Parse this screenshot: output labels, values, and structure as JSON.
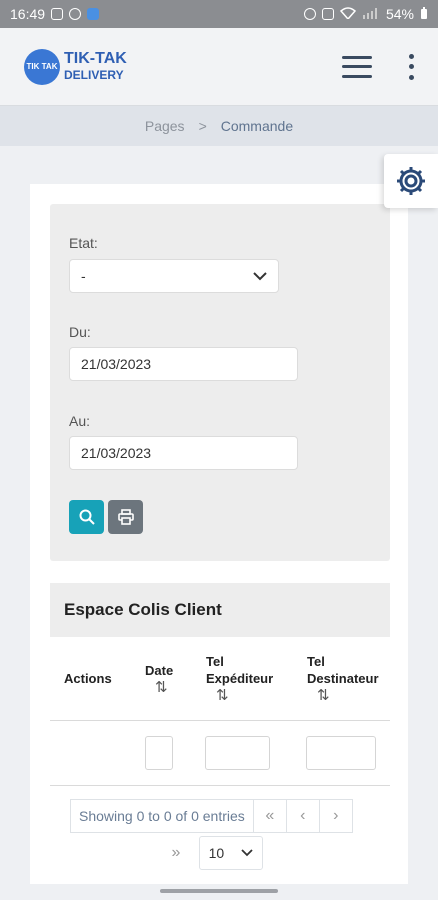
{
  "status_bar": {
    "time": "16:49",
    "battery": "54%"
  },
  "app": {
    "logo_line1": "TIK-TAK",
    "logo_line2": "DELIVERY",
    "logo_badge": "TIK TAK"
  },
  "breadcrumb": {
    "items": [
      "Pages",
      "Commande"
    ],
    "separator": ">"
  },
  "filters": {
    "etat_label": "Etat:",
    "etat_value": "-",
    "du_label": "Du:",
    "du_value": "21/03/2023",
    "au_label": "Au:",
    "au_value": "21/03/2023"
  },
  "table": {
    "title": "Espace Colis Client",
    "columns": [
      "Actions",
      "Date",
      "Tel Expéditeur",
      "Tel Destinateur"
    ],
    "sort_icon": "⇅"
  },
  "pagination": {
    "info": "Showing 0 to 0 of 0 entries",
    "first": "«",
    "prev": "‹",
    "next": "›",
    "last": "»",
    "page_size": "10"
  },
  "colors": {
    "accent": "#17a2b8",
    "secondary": "#6c757d",
    "brand": "#2f5fb3"
  }
}
